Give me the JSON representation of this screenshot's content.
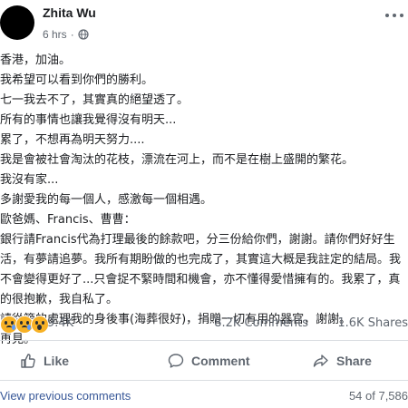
{
  "post": {
    "author": "Zhita Wu",
    "time": "6 hrs",
    "separator": "·",
    "lines": [
      "香港，加油。",
      "我希望可以看到你們的勝利。",
      "七一我去不了，其實真的絕望透了。",
      "所有的事情也讓我覺得沒有明天...",
      "累了，不想再為明天努力....",
      "我是會被社會淘汰的花枝，漂流在河上，而不是在樹上盛開的繁花。",
      "我沒有家...",
      "多謝愛我的每一個人，感激每一個相遇。",
      "歐爸媽、Francis、曹曹：",
      "銀行請Francis代為打理最後的餘款吧，分三份給你們，謝謝。請你們好好生",
      "活，有夢請追夢。我所有期盼做的也完成了，其實這大概是我註定的結局。我",
      "不會變得更好了...只會捉不緊時間和機會，亦不懂得愛惜擁有的。我累了，真",
      "的很抱歉，我自私了。",
      "請從簡的處理我的身後事(海葬很好)，捐贈一切有用的器官，謝謝。",
      "再見。"
    ]
  },
  "stats": {
    "reactions": "9.4K",
    "comments": "8.2K Comments",
    "shares": "1.6K Shares"
  },
  "actions": {
    "like": "Like",
    "comment": "Comment",
    "share": "Share"
  },
  "footer": {
    "view_previous": "View previous comments",
    "counter": "54 of 7,586"
  },
  "icons": {
    "globe": "globe-icon",
    "more": "more-icon",
    "like": "thumbs-up-icon",
    "comment": "comment-bubble-icon",
    "share": "share-arrow-icon"
  },
  "colors": {
    "link": "#385898",
    "secondary_text": "#606770",
    "emoji_yellow": "#f7b125"
  }
}
